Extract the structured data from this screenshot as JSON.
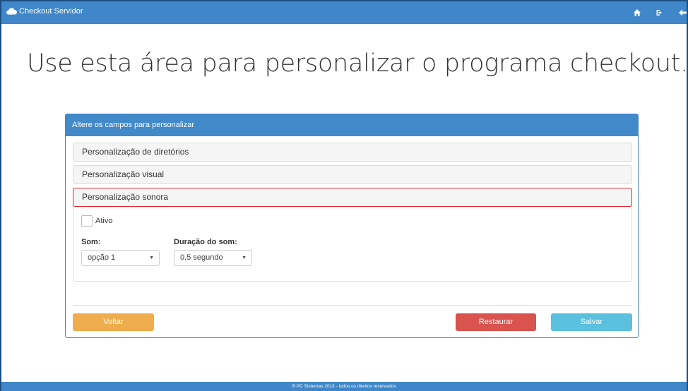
{
  "topbar": {
    "brand": "Checkout Servidor",
    "icons": [
      "home-icon",
      "sign-out-icon",
      "back-arrow-icon"
    ]
  },
  "headline": "Use esta área para personalizar o programa checkout.",
  "panel": {
    "heading": "Altere os campos para personalizar",
    "sections": [
      {
        "label": "Personalização de diretórios"
      },
      {
        "label": "Personalização visual"
      },
      {
        "label": "Personalização sonora",
        "expanded": true,
        "highlighted": true
      }
    ],
    "sound": {
      "ativo_label": "Ativo",
      "ativo_checked": false,
      "som_label": "Som:",
      "som_value": "opção 1",
      "duracao_label": "Duração do som:",
      "duracao_value": "0,5 segundo"
    },
    "buttons": {
      "voltar": "Voltar",
      "restaurar": "Restaurar",
      "salvar": "Salvar"
    }
  },
  "footer": "® PC Sistemas 2013 - todos os direitos reservados",
  "colors": {
    "primary": "#3f87c8",
    "highlight_border": "#d7262e",
    "voltar": "#f0ad4e",
    "restaurar": "#d9534f",
    "salvar": "#5bc0de"
  }
}
